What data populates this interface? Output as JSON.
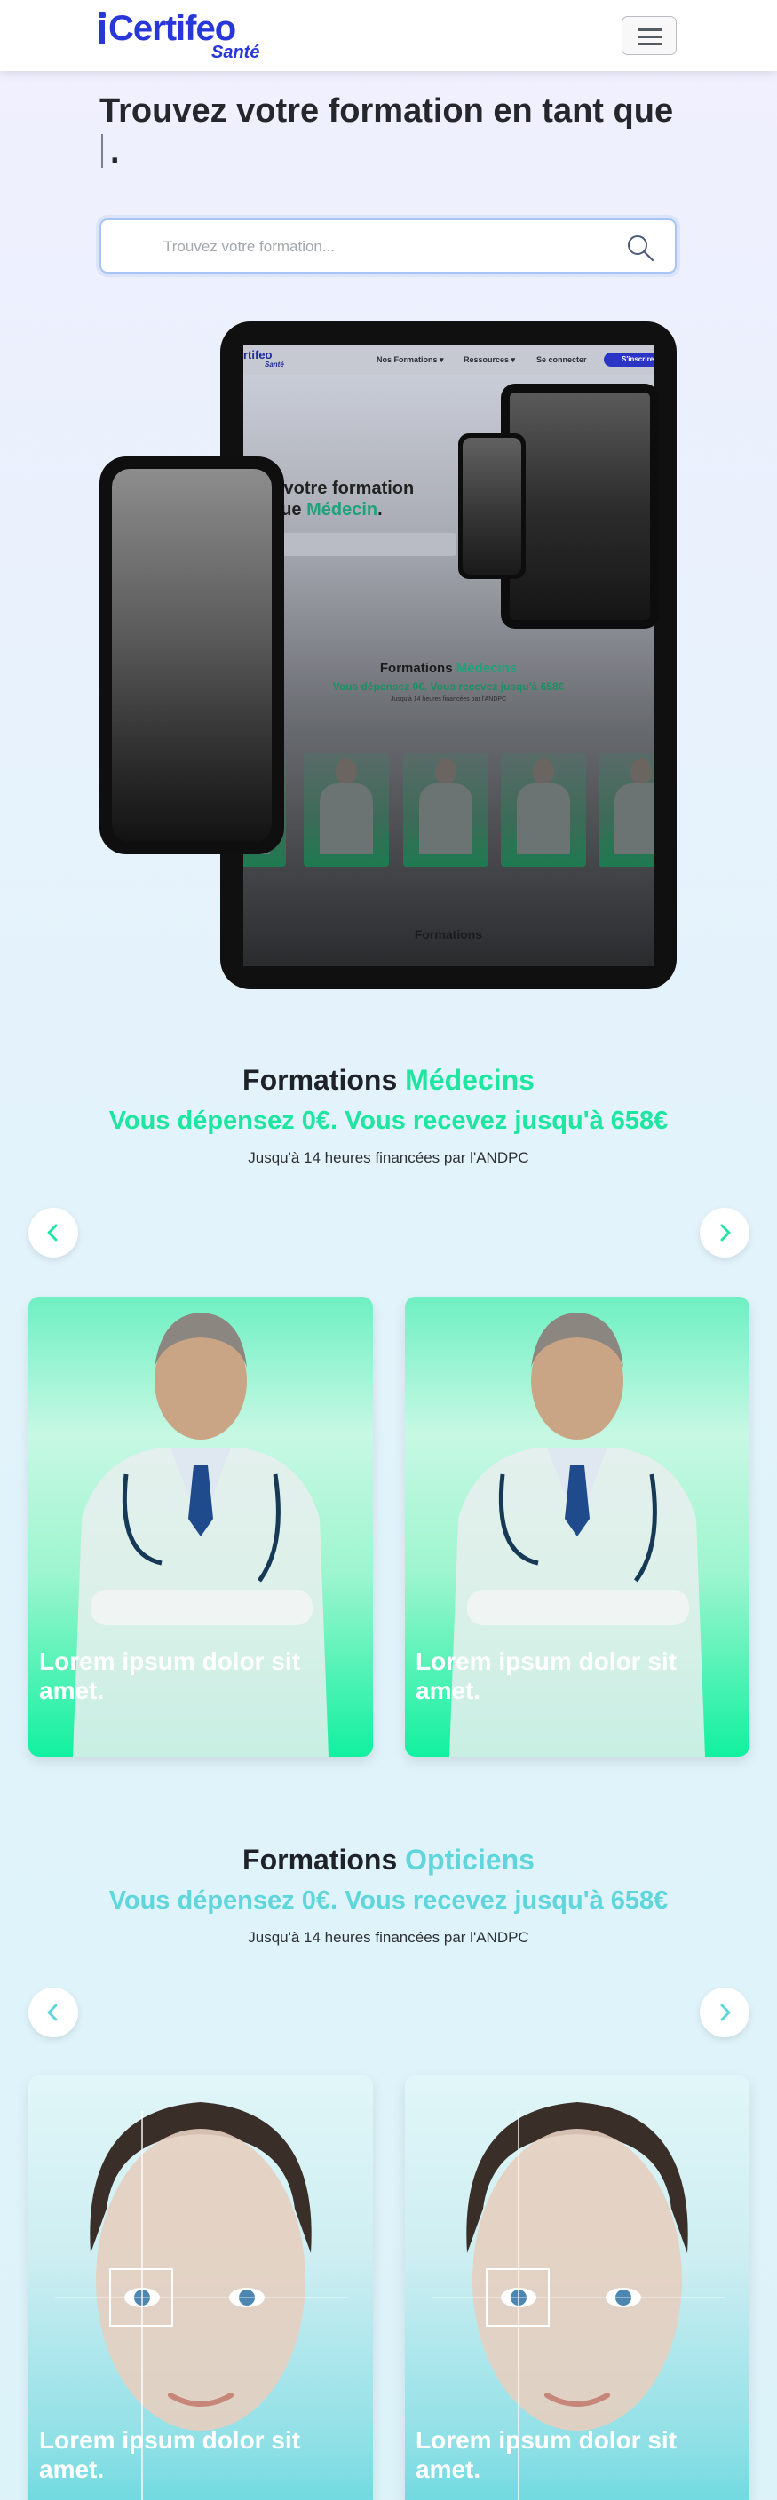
{
  "header": {
    "logo_text": "Certifeo",
    "logo_sub": "Santé",
    "menu_icon": "hamburger-icon"
  },
  "hero": {
    "title": "Trouvez votre formation en tant que",
    "title_end": ".",
    "search_placeholder": "Trouvez votre formation...",
    "search_icon": "search-icon"
  },
  "devices_preview": {
    "tablet_screen": {
      "logo_text": "rtifeo",
      "logo_sub": "Santé",
      "nav_links": [
        "Nos Formations ▾",
        "Ressources ▾",
        "Se connecter"
      ],
      "nav_button": "S'inscrire",
      "hero_line1": "z votre formation",
      "hero_line2_plain": "que ",
      "hero_line2_accent": "Médecin",
      "hero_line2_end": ".",
      "section_title_plain": "Formations ",
      "section_title_accent": "Médecins",
      "section_sub": "Vous dépensez 0€. Vous recevez jusqu'à 658€",
      "section_small": "Jusqu'à 14 heures financées par l'ANDPC",
      "footer_text": "Formations"
    }
  },
  "sections": [
    {
      "title_plain": "Formations ",
      "title_accent": "Médecins",
      "accent_color": "#1ee6a0",
      "subtitle": "Vous dépensez 0€. Vous recevez jusqu'à 658€",
      "small": "Jusqu'à 14 heures financées par l'ANDPC",
      "prev_icon": "chevron-left-icon",
      "next_icon": "chevron-right-icon",
      "cards": [
        {
          "caption": "Lorem ipsum dolor sit amet."
        },
        {
          "caption": "Lorem ipsum dolor sit amet."
        }
      ]
    },
    {
      "title_plain": "Formations ",
      "title_accent": "Opticiens",
      "accent_color": "#5fd6dc",
      "subtitle": "Vous dépensez 0€. Vous recevez jusqu'à 658€",
      "small": "Jusqu'à 14 heures financées par l'ANDPC",
      "prev_icon": "chevron-left-icon",
      "next_icon": "chevron-right-icon",
      "cards": [
        {
          "caption": "Lorem ipsum dolor sit amet."
        },
        {
          "caption": "Lorem ipsum dolor sit amet."
        }
      ]
    }
  ]
}
